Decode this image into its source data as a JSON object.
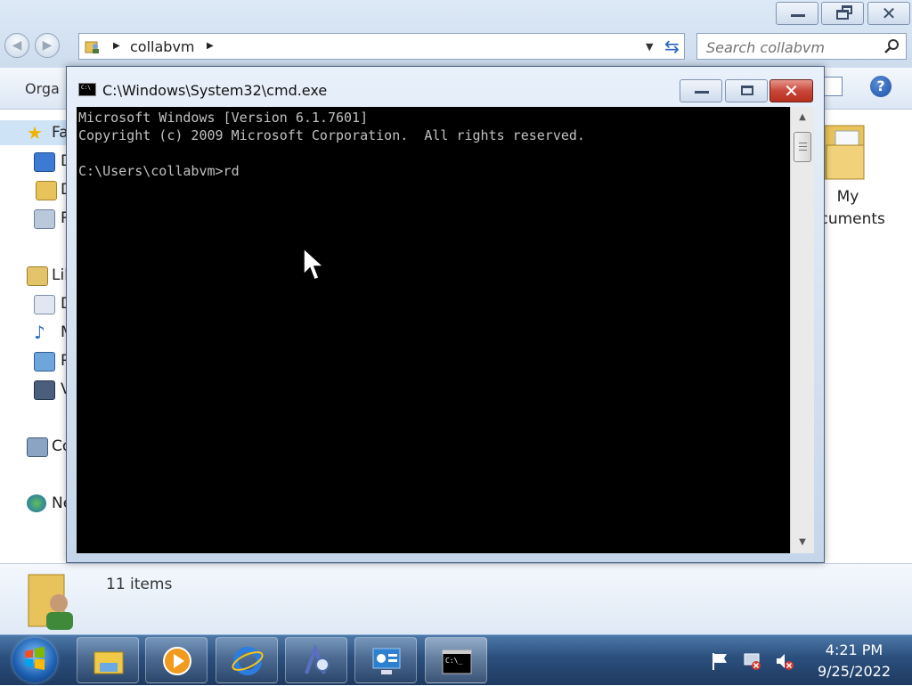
{
  "explorer": {
    "breadcrumb": "collabvm",
    "search_placeholder": "Search collabvm",
    "organize_label": "Orga",
    "nav_items": [
      {
        "label": "Fa",
        "icon": "favorites-star-icon"
      },
      {
        "label": "D",
        "icon": "desktop-icon"
      },
      {
        "label": "D",
        "icon": "downloads-folder-icon"
      },
      {
        "label": "R",
        "icon": "recent-places-icon"
      },
      {
        "label": "Lib",
        "icon": "libraries-icon"
      },
      {
        "label": "D",
        "icon": "documents-library-icon"
      },
      {
        "label": "M",
        "icon": "music-library-icon"
      },
      {
        "label": "P",
        "icon": "pictures-library-icon"
      },
      {
        "label": "V",
        "icon": "videos-library-icon"
      },
      {
        "label": "Co",
        "icon": "computer-icon"
      },
      {
        "label": "Ne",
        "icon": "network-icon"
      }
    ],
    "content_item": {
      "label": "My\nocuments",
      "icon": "my-documents-folder-icon"
    },
    "item_count": "11 items"
  },
  "cmd": {
    "title": "C:\\Windows\\System32\\cmd.exe",
    "console_text": "Microsoft Windows [Version 6.1.7601]\nCopyright (c) 2009 Microsoft Corporation.  All rights reserved.\n\nC:\\Users\\collabvm>rd"
  },
  "taskbar": {
    "pinned": [
      {
        "name": "windows-explorer-icon"
      },
      {
        "name": "media-player-icon"
      },
      {
        "name": "internet-explorer-icon"
      },
      {
        "name": "search-app-icon"
      },
      {
        "name": "control-panel-icon"
      },
      {
        "name": "cmd-icon"
      }
    ],
    "tray": [
      "action-center-flag-icon",
      "network-disconnected-icon",
      "volume-muted-icon"
    ],
    "time": "4:21 PM",
    "date": "9/25/2022"
  },
  "colors": {
    "console_bg": "#000000",
    "console_text": "#c0c0c0",
    "taskbar": "#2b4f7d",
    "close_red": "#c9473a"
  }
}
